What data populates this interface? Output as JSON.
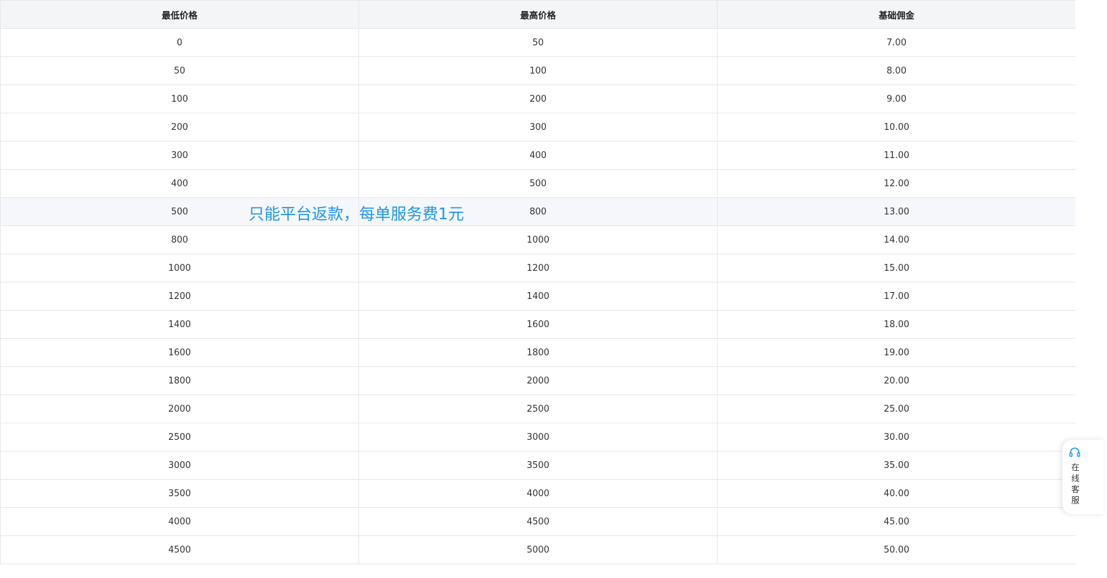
{
  "table": {
    "headers": [
      "最低价格",
      "最高价格",
      "基础佣金"
    ],
    "rows": [
      [
        "0",
        "50",
        "7.00"
      ],
      [
        "50",
        "100",
        "8.00"
      ],
      [
        "100",
        "200",
        "9.00"
      ],
      [
        "200",
        "300",
        "10.00"
      ],
      [
        "300",
        "400",
        "11.00"
      ],
      [
        "400",
        "500",
        "12.00"
      ],
      [
        "500",
        "800",
        "13.00"
      ],
      [
        "800",
        "1000",
        "14.00"
      ],
      [
        "1000",
        "1200",
        "15.00"
      ],
      [
        "1200",
        "1400",
        "17.00"
      ],
      [
        "1400",
        "1600",
        "18.00"
      ],
      [
        "1600",
        "1800",
        "19.00"
      ],
      [
        "1800",
        "2000",
        "20.00"
      ],
      [
        "2000",
        "2500",
        "25.00"
      ],
      [
        "2500",
        "3000",
        "30.00"
      ],
      [
        "3000",
        "3500",
        "35.00"
      ],
      [
        "3500",
        "4000",
        "40.00"
      ],
      [
        "4000",
        "4500",
        "45.00"
      ],
      [
        "4500",
        "5000",
        "50.00"
      ]
    ],
    "hovered_row_index": 6
  },
  "overlay_note": "只能平台返款，每单服务费1元",
  "customer_service": {
    "label": "在线客服",
    "icon": "headset-icon",
    "accent_color": "#1e96e8"
  },
  "colors": {
    "header_bg": "#f4f5f7",
    "border": "#e4e6ea",
    "note_text": "#1e96e8",
    "hover_row_bg": "#f5f7fa"
  }
}
